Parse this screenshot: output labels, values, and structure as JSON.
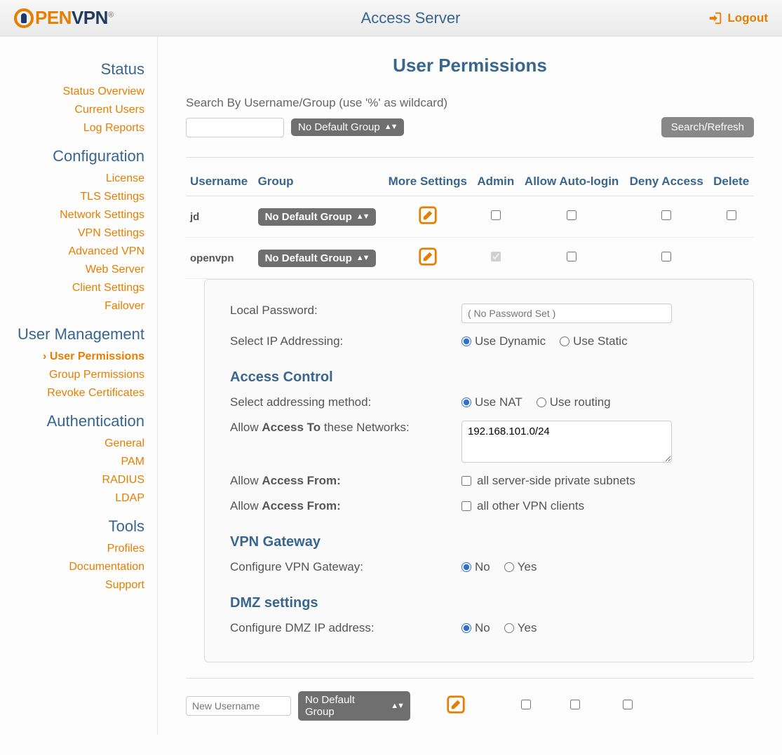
{
  "header": {
    "logo_open": "PEN",
    "logo_vpn": "VPN",
    "title": "Access Server",
    "logout": "Logout"
  },
  "sidebar": {
    "status_h": "Status",
    "status": [
      "Status Overview",
      "Current Users",
      "Log Reports"
    ],
    "config_h": "Configuration",
    "config": [
      "License",
      "TLS Settings",
      "Network Settings",
      "VPN Settings",
      "Advanced VPN",
      "Web Server",
      "Client Settings",
      "Failover"
    ],
    "usermgmt_h": "User Management",
    "usermgmt": [
      "User Permissions",
      "Group Permissions",
      "Revoke Certificates"
    ],
    "auth_h": "Authentication",
    "auth": [
      "General",
      "PAM",
      "RADIUS",
      "LDAP"
    ],
    "tools_h": "Tools",
    "tools": [
      "Profiles",
      "Documentation",
      "Support"
    ]
  },
  "page": {
    "title": "User Permissions"
  },
  "search": {
    "label": "Search By Username/Group (use '%' as wildcard)",
    "group_default": "No Default Group",
    "btn": "Search/Refresh"
  },
  "table": {
    "headers": {
      "username": "Username",
      "group": "Group",
      "more": "More Settings",
      "admin": "Admin",
      "auto": "Allow Auto-login",
      "deny": "Deny Access",
      "delete": "Delete"
    },
    "rows": [
      {
        "username": "jd",
        "group": "No Default Group",
        "admin": false,
        "auto": false,
        "deny": false,
        "delete": false
      },
      {
        "username": "openvpn",
        "group": "No Default Group",
        "admin": true,
        "auto": false,
        "deny": false
      }
    ]
  },
  "panel": {
    "local_password_label": "Local Password:",
    "local_password_placeholder": "( No Password Set )",
    "ip_label": "Select IP Addressing:",
    "ip_dynamic": "Use Dynamic",
    "ip_static": "Use Static",
    "access_control_h": "Access Control",
    "addr_method_label": "Select addressing method:",
    "addr_nat": "Use NAT",
    "addr_routing": "Use routing",
    "allow_to_pre": "Allow ",
    "allow_to_b": "Access To",
    "allow_to_post": " these Networks:",
    "networks_value": "192.168.101.0/24",
    "allow_from_pre": "Allow ",
    "allow_from_b": "Access From:",
    "from_subnets": "all server-side private subnets",
    "from_clients": "all other VPN clients",
    "vpn_gw_h": "VPN Gateway",
    "vpn_gw_label": "Configure VPN Gateway:",
    "dmz_h": "DMZ settings",
    "dmz_label": "Configure DMZ IP address:",
    "no": "No",
    "yes": "Yes"
  },
  "newrow": {
    "placeholder": "New Username",
    "group": "No Default Group"
  }
}
